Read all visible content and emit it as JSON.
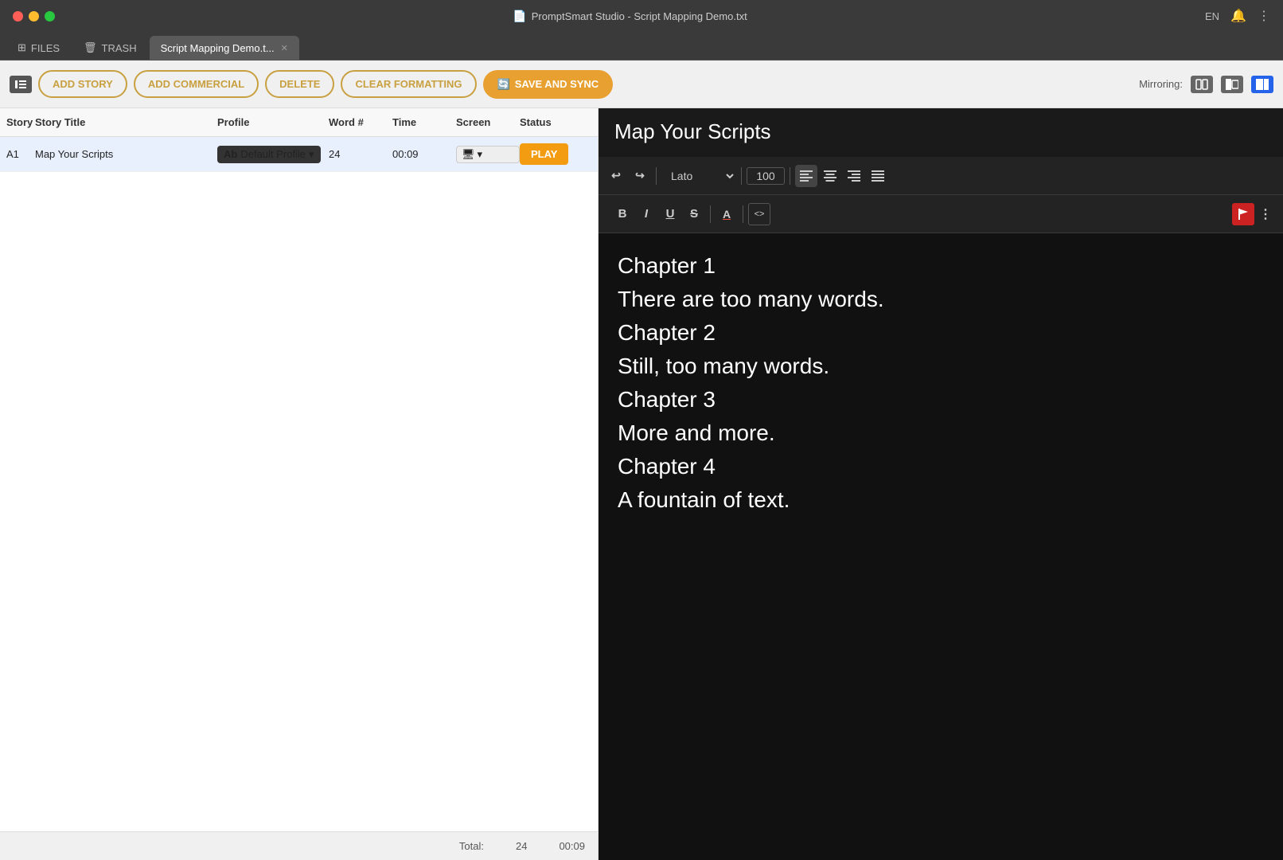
{
  "titlebar": {
    "app_name": "PromptSmart Studio - Script Mapping Demo.txt",
    "language": "EN",
    "file_icon": "📄"
  },
  "tabs": [
    {
      "id": "files",
      "label": "FILES",
      "icon": "⊞",
      "active": false
    },
    {
      "id": "trash",
      "label": "TRASH",
      "icon": "🗑",
      "active": false
    },
    {
      "id": "script",
      "label": "Script Mapping Demo.t...",
      "active": true,
      "closeable": true
    }
  ],
  "toolbar": {
    "add_story": "ADD STORY",
    "add_commercial": "ADD COMMERCIAL",
    "delete": "DELETE",
    "clear_formatting": "CLEAR FORMATTING",
    "save_and_sync": "SAVE AND SYNC",
    "mirroring_label": "Mirroring:"
  },
  "table": {
    "headers": [
      "Story",
      "Story Title",
      "Profile",
      "Word #",
      "Time",
      "Screen",
      "Status"
    ],
    "rows": [
      {
        "story": "A1",
        "title": "Map Your Scripts",
        "profile": "Default Profile",
        "words": "24",
        "time": "00:09",
        "screen": "⬛",
        "status": "PLAY"
      }
    ],
    "footer": {
      "total_label": "Total:",
      "total_words": "24",
      "total_time": "00:09"
    }
  },
  "script_editor": {
    "title": "Map Your Scripts",
    "font": "Lato",
    "font_size": "100",
    "content": [
      "Chapter 1",
      "There are too many words.",
      "Chapter 2",
      "Still, too many words.",
      "Chapter 3",
      "More and more.",
      "Chapter 4",
      "A fountain of text."
    ],
    "buttons": {
      "bold": "B",
      "italic": "I",
      "underline": "U",
      "strikethrough": "S",
      "font_color": "A",
      "code": "<>",
      "flag": "⚑",
      "undo": "↩",
      "redo": "↪",
      "align_left": "≡",
      "align_center": "≡",
      "align_right": "≡",
      "align_justify": "≡"
    }
  }
}
